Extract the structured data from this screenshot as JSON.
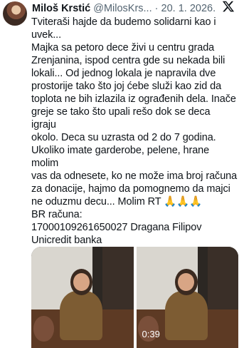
{
  "author": {
    "name": "Miloš Krstić",
    "handle": "@MilosKrs...",
    "separator": "·",
    "date": "20. 1. 2026."
  },
  "tweet": {
    "text": "Tviteraši hajde da budemo solidarni kao i\nuvek...\nMajka sa petoro dece živi u centru grada\nZrenjanina, ispod centra gde su nekada bili\nlokali... Od jednog lokala je napravila dve\nprostorije tako što joj ćebe služi kao zid da\ntoplota ne bih izlazila iz ograđenih dela. Inače\ngreje se tako što upali rešo dok se deca igraju\nokolo. Deca su uzrasta od 2 do 7 godina.\nUkoliko imate garderobe, pelene, hrane molim\nvas da odnesete, ko ne može ima broj računa\nza donacije, hajmo da pomognemo da majci\nne oduzmu decu... Molim RT 🙏🙏🙏\nBR računa:\n17000109261650027 Dragana Filipov\nUnicredit banka"
  },
  "media": {
    "duration": "0:39"
  },
  "icons": {
    "close": "x-logo-icon",
    "avatar": "avatar-photo"
  }
}
